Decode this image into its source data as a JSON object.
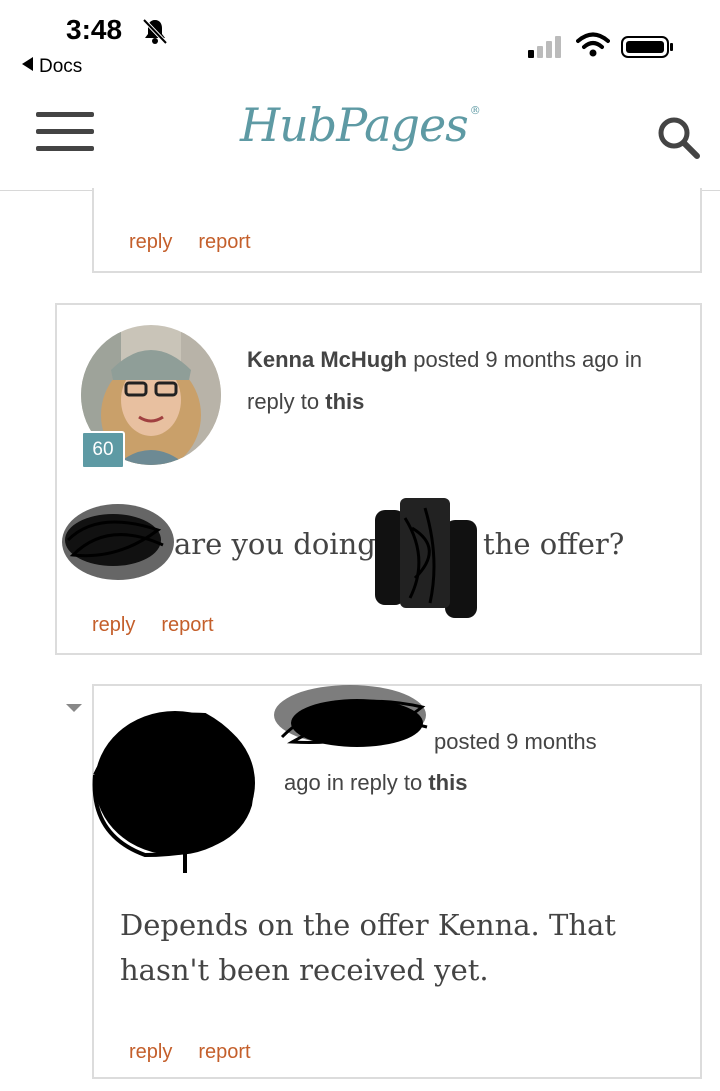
{
  "status_bar": {
    "time": "3:48",
    "back_app": "Docs"
  },
  "header": {
    "logo": "HubPages",
    "registered": "®"
  },
  "comments": [
    {
      "actions": {
        "reply": "reply",
        "report": "report"
      }
    },
    {
      "author": "Kenna McHugh",
      "posted": "posted 9 months ago in reply to",
      "this_link": "this",
      "score": "60",
      "text_part1": "are you doing",
      "text_part2": "the offer?",
      "actions": {
        "reply": "reply",
        "report": "report"
      }
    },
    {
      "posted": "posted 9 months",
      "posted_line2": "ago in reply to",
      "this_link": "this",
      "text": "Depends on the offer Kenna. That hasn't been received yet.",
      "actions": {
        "reply": "reply",
        "report": "report"
      }
    }
  ],
  "colors": {
    "brand": "#5e9aa4",
    "action": "#c45f2b",
    "border": "#dcdcdc"
  }
}
